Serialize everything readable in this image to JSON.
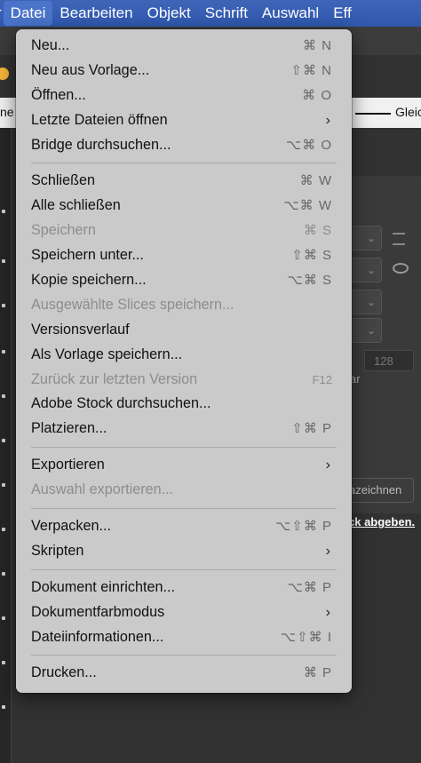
{
  "menubar": {
    "items": [
      {
        "label": "r",
        "active": false
      },
      {
        "label": "Datei",
        "active": true
      },
      {
        "label": "Bearbeiten",
        "active": false
      },
      {
        "label": "Objekt",
        "active": false
      },
      {
        "label": "Schrift",
        "active": false
      },
      {
        "label": "Auswahl",
        "active": false
      },
      {
        "label": "Eff",
        "active": false
      }
    ]
  },
  "background_app": {
    "control_bar_left": "ne",
    "control_bar_right": "Gleic",
    "number_field": "128",
    "side_text": "ar",
    "button_label": "azeichnen",
    "link_text": "ck abgeben."
  },
  "menu": {
    "groups": [
      [
        {
          "label": "Neu...",
          "shortcut": "⌘ N"
        },
        {
          "label": "Neu aus Vorlage...",
          "shortcut": "⇧⌘ N"
        },
        {
          "label": "Öffnen...",
          "shortcut": "⌘ O"
        },
        {
          "label": "Letzte Dateien öffnen",
          "submenu": true
        },
        {
          "label": "Bridge durchsuchen...",
          "shortcut": "⌥⌘ O"
        }
      ],
      [
        {
          "label": "Schließen",
          "shortcut": "⌘ W"
        },
        {
          "label": "Alle schließen",
          "shortcut": "⌥⌘ W"
        },
        {
          "label": "Speichern",
          "shortcut": "⌘ S",
          "disabled": true
        },
        {
          "label": "Speichern unter...",
          "shortcut": "⇧⌘ S"
        },
        {
          "label": "Kopie speichern...",
          "shortcut": "⌥⌘ S"
        },
        {
          "label": "Ausgewählte Slices speichern...",
          "disabled": true
        },
        {
          "label": "Versionsverlauf"
        },
        {
          "label": "Als Vorlage speichern..."
        },
        {
          "label": "Zurück zur letzten Version",
          "shortcut": "F12",
          "disabled": true,
          "fkey": true
        },
        {
          "label": "Adobe Stock durchsuchen..."
        },
        {
          "label": "Platzieren...",
          "shortcut": "⇧⌘ P"
        }
      ],
      [
        {
          "label": "Exportieren",
          "submenu": true
        },
        {
          "label": "Auswahl exportieren...",
          "disabled": true
        }
      ],
      [
        {
          "label": "Verpacken...",
          "shortcut": "⌥⇧⌘ P"
        },
        {
          "label": "Skripten",
          "submenu": true
        }
      ],
      [
        {
          "label": "Dokument einrichten...",
          "shortcut": "⌥⌘ P"
        },
        {
          "label": "Dokumentfarbmodus",
          "submenu": true
        },
        {
          "label": "Dateiinformationen...",
          "shortcut": "⌥⇧⌘ I"
        }
      ],
      [
        {
          "label": "Drucken...",
          "shortcut": "⌘ P"
        }
      ]
    ]
  }
}
